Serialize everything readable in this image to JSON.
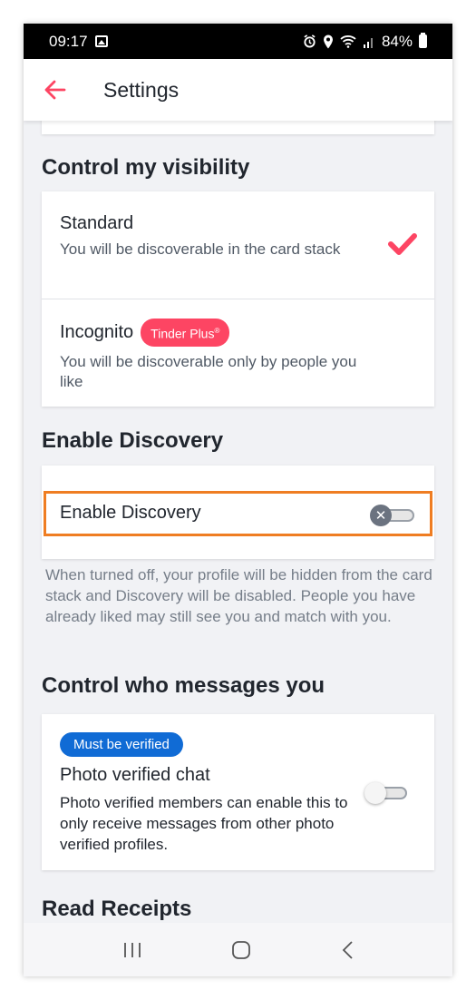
{
  "status_bar": {
    "time": "09:17",
    "battery": "84%"
  },
  "app_bar": {
    "title": "Settings"
  },
  "visibility": {
    "heading": "Control my visibility",
    "options": [
      {
        "title": "Standard",
        "subtitle": "You will be discoverable in the card stack",
        "selected": true
      },
      {
        "title": "Incognito",
        "badge": "Tinder Plus",
        "badge_mark": "®",
        "subtitle": "You will be discoverable only by people you like",
        "selected": false
      }
    ]
  },
  "discovery": {
    "heading": "Enable Discovery",
    "toggle_label": "Enable Discovery",
    "enabled": false,
    "note": "When turned off, your profile will be hidden from the card stack and Discovery will be disabled. People you have already liked may still see you and match with you."
  },
  "messages": {
    "heading": "Control who messages you",
    "badge": "Must be verified",
    "title": "Photo verified chat",
    "description": "Photo verified members can enable this to only receive messages from other photo verified profiles.",
    "enabled": false
  },
  "read_receipts": {
    "heading": "Read Receipts"
  },
  "colors": {
    "accent": "#fd4563",
    "verified_blue": "#106bd5",
    "highlight": "#ef7d22"
  },
  "icons": {
    "back": "arrow-left-icon",
    "check": "check-icon",
    "toggle_off": "x-icon",
    "nav_recent": "recent-apps-icon",
    "nav_home": "home-icon",
    "nav_back": "back-chevron-icon"
  }
}
